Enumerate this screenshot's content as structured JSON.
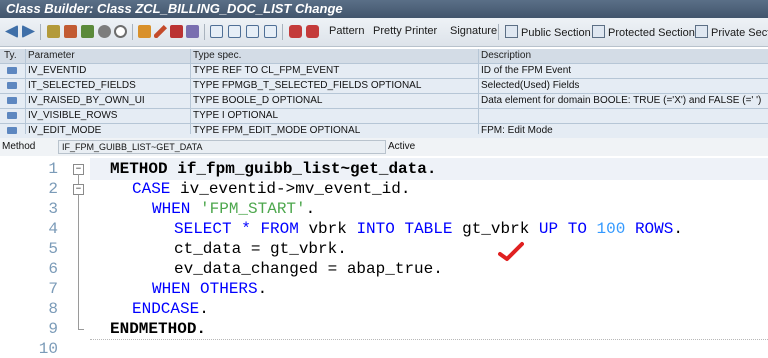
{
  "window": {
    "title": "Class Builder: Class ZCL_BILLING_DOC_LIST Change"
  },
  "toolbar": {
    "buttons": {
      "pattern": "Pattern",
      "pretty_printer": "Pretty Printer",
      "signature": "Signature",
      "public_section": "Public Section",
      "protected_section": "Protected Section",
      "private_section": "Private Sectio"
    }
  },
  "params_table": {
    "headers": {
      "ty": "Ty.",
      "parameter": "Parameter",
      "typespec": "Type spec.",
      "description": "Description"
    },
    "rows": [
      {
        "parameter": "IV_EVENTID",
        "typespec": "TYPE REF TO CL_FPM_EVENT",
        "description": "ID of the FPM Event"
      },
      {
        "parameter": "IT_SELECTED_FIELDS",
        "typespec": "TYPE FPMGB_T_SELECTED_FIELDS OPTIONAL",
        "description": "Selected(Used) Fields"
      },
      {
        "parameter": "IV_RAISED_BY_OWN_UI",
        "typespec": "TYPE BOOLE_D OPTIONAL",
        "description": "Data element for domain BOOLE: TRUE (='X') and FALSE (=' ')"
      },
      {
        "parameter": "IV_VISIBLE_ROWS",
        "typespec": "TYPE I OPTIONAL",
        "description": ""
      },
      {
        "parameter": "IV_EDIT_MODE",
        "typespec": "TYPE FPM_EDIT_MODE OPTIONAL",
        "description": "FPM: Edit Mode"
      }
    ]
  },
  "method_bar": {
    "label": "Method",
    "value": "IF_FPM_GUIBB_LIST~GET_DATA",
    "status": "Active"
  },
  "editor": {
    "line_numbers": [
      "1",
      "2",
      "3",
      "4",
      "5",
      "6",
      "7",
      "8",
      "9",
      "10"
    ],
    "fold_markers": {
      "open": "−"
    },
    "lines": [
      [
        "METHOD",
        " if_fpm_guibb_list~get_data."
      ],
      [
        "CASE",
        " iv_eventid->mv_event_id."
      ],
      [
        "WHEN",
        " ",
        "'FPM_START'",
        "."
      ],
      [
        "SELECT",
        " ",
        "*",
        " ",
        "FROM",
        " vbrk ",
        "INTO",
        " ",
        "TABLE",
        " gt_vbrk ",
        "UP",
        " ",
        "TO",
        " ",
        "100",
        " ",
        "ROWS",
        "."
      ],
      [
        "ct_data = gt_vbrk."
      ],
      [
        "ev_data_changed = abap_true."
      ],
      [
        "WHEN",
        " ",
        "OTHERS",
        "."
      ],
      [
        "ENDCASE",
        "."
      ],
      [
        "ENDMETHOD",
        "."
      ]
    ]
  },
  "colors": {
    "keyword": "#0000ff",
    "string": "#4da74d",
    "number": "#3399ff",
    "checkmark": "#e02020"
  }
}
